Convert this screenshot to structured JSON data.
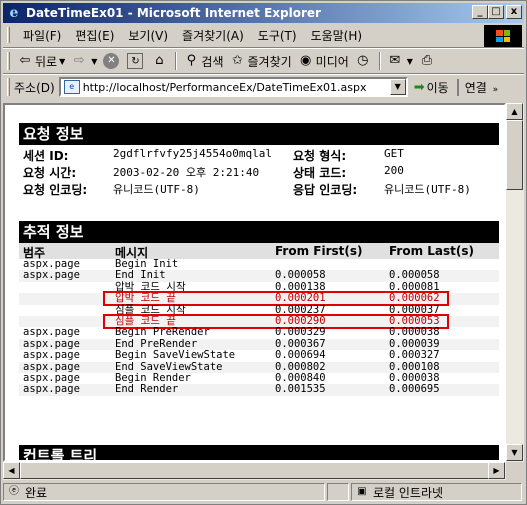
{
  "window": {
    "title": "DateTimeEx01 - Microsoft Internet Explorer",
    "ie_icon": "e",
    "btn_min": "_",
    "btn_max": "□",
    "btn_close": "x"
  },
  "menu": [
    "파일(F)",
    "편집(E)",
    "보기(V)",
    "즐겨찾기(A)",
    "도구(T)",
    "도움말(H)"
  ],
  "toolbar": {
    "back_label": "뒤로",
    "search_label": "검색",
    "favorites_label": "즐겨찾기",
    "media_label": "미디어"
  },
  "address": {
    "label": "주소(D)",
    "url": "http://localhost/PerformanceEx/DateTimeEx01.aspx",
    "go_label": "이동",
    "links_label": "연결",
    "links_more": "»"
  },
  "request_info": {
    "header": "요청 정보",
    "rows": [
      {
        "label1": "세션 ID:",
        "value1": "2gdflrfvfy25j4554o0mqlal",
        "label2": "요청 형식:",
        "value2": "GET"
      },
      {
        "label1": "요청 시간:",
        "value1": "2003-02-20 오후 2:21:40",
        "label2": "상태 코드:",
        "value2": "200"
      },
      {
        "label1": "요청 인코딩:",
        "value1": "유니코드(UTF-8)",
        "label2": "응답 인코딩:",
        "value2": "유니코드(UTF-8)"
      }
    ]
  },
  "trace_info": {
    "header": "추적 정보",
    "columns": [
      "범주",
      "메시지",
      "From First(s)",
      "From Last(s)"
    ],
    "rows": [
      {
        "category": "aspx.page",
        "message": "Begin Init",
        "first": "",
        "last": "",
        "highlight": false
      },
      {
        "category": "aspx.page",
        "message": "End Init",
        "first": "0.000058",
        "last": "0.000058",
        "highlight": false
      },
      {
        "category": "",
        "message": "압박 코드 시작",
        "first": "0.000138",
        "last": "0.000081",
        "highlight": false
      },
      {
        "category": "",
        "message": "압박 코드 끝",
        "first": "0.000201",
        "last": "0.000062",
        "highlight": true
      },
      {
        "category": "",
        "message": "심플 코드 시작",
        "first": "0.000237",
        "last": "0.000037",
        "highlight": false
      },
      {
        "category": "",
        "message": "심플 코드 끝",
        "first": "0.000290",
        "last": "0.000053",
        "highlight": true
      },
      {
        "category": "aspx.page",
        "message": "Begin PreRender",
        "first": "0.000329",
        "last": "0.000038",
        "highlight": false
      },
      {
        "category": "aspx.page",
        "message": "End PreRender",
        "first": "0.000367",
        "last": "0.000039",
        "highlight": false
      },
      {
        "category": "aspx.page",
        "message": "Begin SaveViewState",
        "first": "0.000694",
        "last": "0.000327",
        "highlight": false
      },
      {
        "category": "aspx.page",
        "message": "End SaveViewState",
        "first": "0.000802",
        "last": "0.000108",
        "highlight": false
      },
      {
        "category": "aspx.page",
        "message": "Begin Render",
        "first": "0.000840",
        "last": "0.000038",
        "highlight": false
      },
      {
        "category": "aspx.page",
        "message": "End Render",
        "first": "0.001535",
        "last": "0.000695",
        "highlight": false
      }
    ]
  },
  "control_tree": {
    "header": "컨트롤 트리"
  },
  "status": {
    "text": "완료",
    "zone": "로컬 인트라넷"
  },
  "colors": {
    "highlight_border": "#e00000",
    "highlight_text": "#c00000",
    "section_bg": "#000000",
    "title_gradient_start": "#0a246a"
  }
}
